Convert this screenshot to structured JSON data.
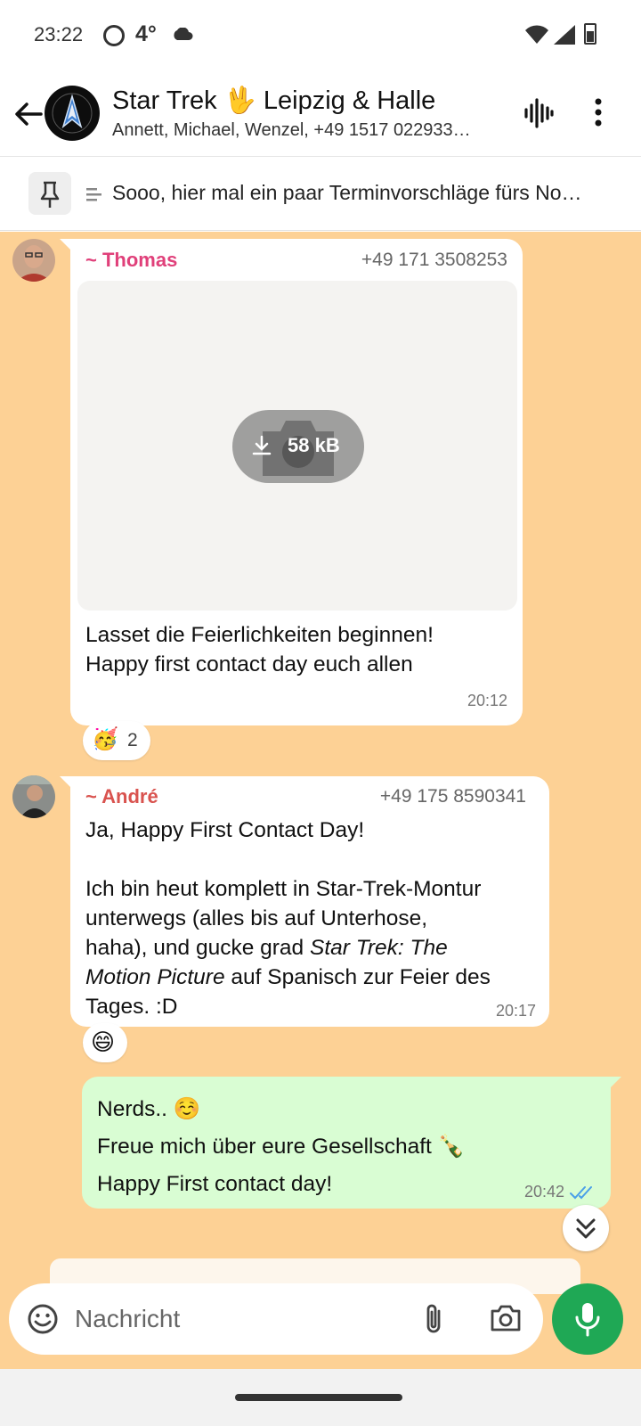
{
  "status_bar": {
    "time": "23:22",
    "temperature": "4°"
  },
  "header": {
    "title": "Star Trek 🖖 Leipzig & Halle",
    "subtitle": "Annett, Michael, Wenzel, +49 1517 022933…"
  },
  "pinned": {
    "text": "Sooo, hier mal ein paar Terminvorschläge fürs No…"
  },
  "messages": [
    {
      "sender": "~ Thomas",
      "phone": "+49 171 3508253",
      "media_size": "58 kB",
      "line1": "Lasset die Feierlichkeiten beginnen!",
      "line2": "Happy first contact day euch allen",
      "time": "20:12",
      "reaction": "🥳",
      "reaction_count": "2"
    },
    {
      "sender": "~ André",
      "phone": "+49 175 8590341",
      "line1": "Ja, Happy First Contact Day!",
      "line2": "Ich bin heut komplett in Star-Trek-Montur",
      "line3": "unterwegs (alles bis auf Unterhose,",
      "line4_a": "haha), und gucke grad ",
      "line4_b": "Star Trek: The",
      "line5_a": "Motion Picture",
      "line5_b": " auf Spanisch zur Feier des",
      "line6": "Tages. :D",
      "time": "20:17",
      "reaction": "😄"
    },
    {
      "line1": "Nerds.. ☺️",
      "line2": "Freue mich über eure Gesellschaft 🍾",
      "line3": "Happy First contact day!",
      "time": "20:42"
    }
  ],
  "composer": {
    "placeholder": "Nachricht"
  },
  "colors": {
    "chat_background": "#fdd195",
    "outgoing_bubble": "#d9fdd3",
    "thomas_name": "#e0407a",
    "andre_name": "#d9534f",
    "mic_button": "#1fa855",
    "read_ticks": "#4a9fe8"
  },
  "icons": [
    "back-arrow-icon",
    "voice-chat-icon",
    "more-vert-icon",
    "pin-icon",
    "download-icon",
    "camera-icon",
    "double-chevron-down-icon",
    "emoji-icon",
    "paperclip-icon",
    "microphone-icon"
  ]
}
